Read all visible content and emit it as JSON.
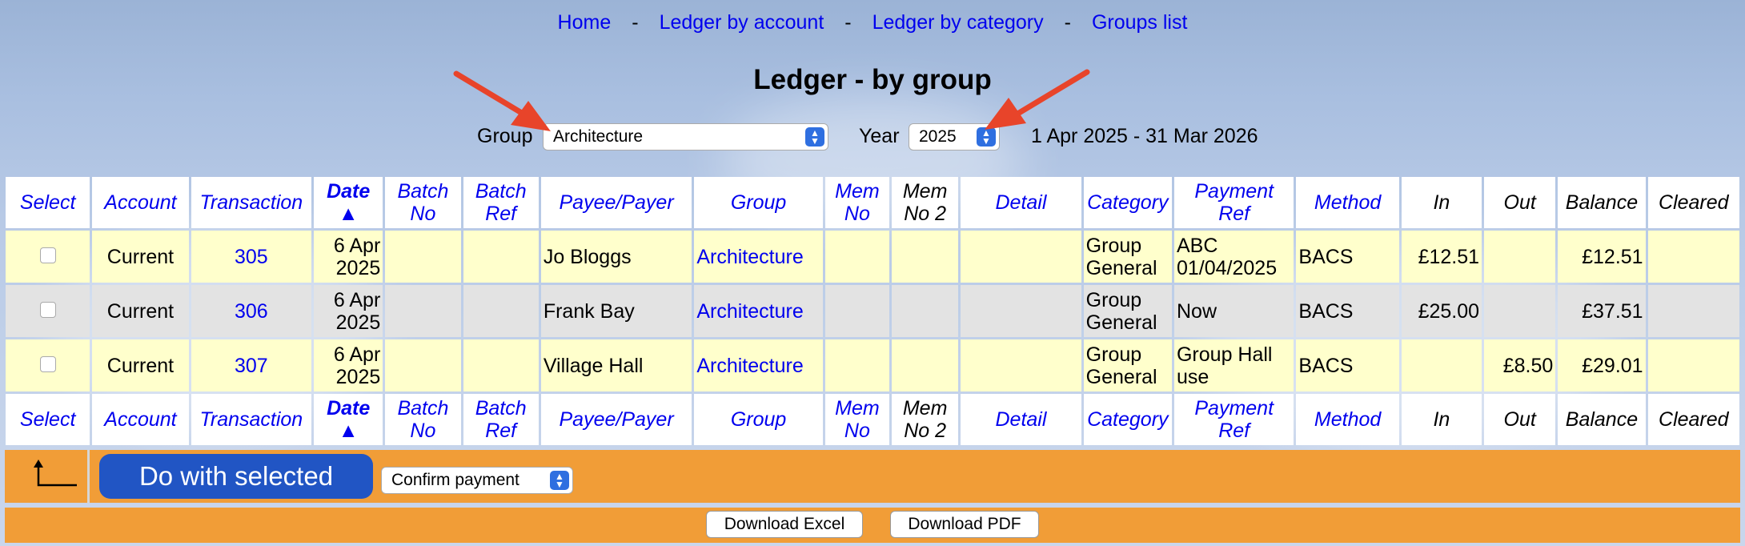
{
  "nav": {
    "items": [
      "Home",
      "Ledger by account",
      "Ledger by category",
      "Groups list"
    ],
    "separator": "-"
  },
  "page_title": "Ledger - by group",
  "controls": {
    "group_label": "Group",
    "group_value": "Architecture",
    "year_label": "Year",
    "year_value": "2025",
    "date_range": "1 Apr 2025 - 31 Mar 2026"
  },
  "table": {
    "headers": [
      "Select",
      "Account",
      "Transaction",
      "Date ▲",
      "Batch No",
      "Batch Ref",
      "Payee/Payer",
      "Group",
      "Mem No",
      "Mem No 2",
      "Detail",
      "Category",
      "Payment Ref",
      "Method",
      "In",
      "Out",
      "Balance",
      "Cleared"
    ],
    "rows": [
      {
        "account": "Current",
        "transaction": "305",
        "date": "6 Apr 2025",
        "batch_no": "",
        "batch_ref": "",
        "payee": "Jo Bloggs",
        "group": "Architecture",
        "mem_no": "",
        "mem_no_2": "",
        "detail": "",
        "category": "Group General",
        "payment_ref": "ABC 01/04/2025",
        "method": "BACS",
        "in": "£12.51",
        "out": "",
        "balance": "£12.51",
        "cleared": ""
      },
      {
        "account": "Current",
        "transaction": "306",
        "date": "6 Apr 2025",
        "batch_no": "",
        "batch_ref": "",
        "payee": "Frank Bay",
        "group": "Architecture",
        "mem_no": "",
        "mem_no_2": "",
        "detail": "",
        "category": "Group General",
        "payment_ref": "Now",
        "method": "BACS",
        "in": "£25.00",
        "out": "",
        "balance": "£37.51",
        "cleared": ""
      },
      {
        "account": "Current",
        "transaction": "307",
        "date": "6 Apr 2025",
        "batch_no": "",
        "batch_ref": "",
        "payee": "Village Hall",
        "group": "Architecture",
        "mem_no": "",
        "mem_no_2": "",
        "detail": "",
        "category": "Group General",
        "payment_ref": "Group Hall use",
        "method": "BACS",
        "in": "",
        "out": "£8.50",
        "balance": "£29.01",
        "cleared": ""
      }
    ]
  },
  "actions": {
    "return_icon": "return-arrow-icon",
    "do_with_selected": "Do with selected",
    "action_value": "Confirm payment",
    "download_excel": "Download Excel",
    "download_pdf": "Download PDF"
  },
  "colors": {
    "link": "#0000ee",
    "row_yellow": "#ffffcc",
    "row_grey": "#e3e3e3",
    "action_bar": "#f19d37",
    "primary_button": "#2155c4",
    "annotation_arrow": "#e8442a"
  }
}
